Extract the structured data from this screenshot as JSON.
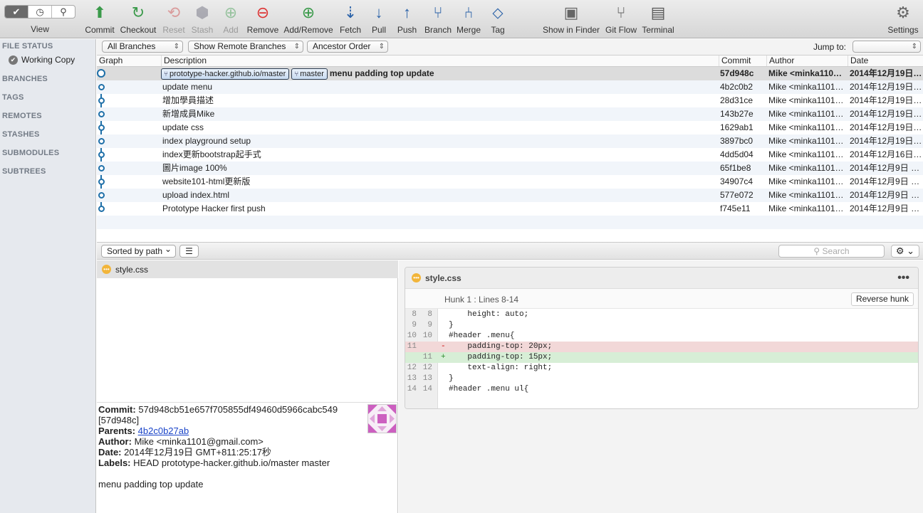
{
  "toolbar": {
    "view_label": "View",
    "view_segments": [
      "✔",
      "◷",
      "⚲"
    ],
    "buttons": [
      {
        "label": "Commit",
        "icon": "⬆"
      },
      {
        "label": "Checkout",
        "icon": "↻"
      },
      {
        "label": "Reset",
        "icon": "⟲"
      },
      {
        "label": "Stash",
        "icon": "⬢"
      },
      {
        "label": "Add",
        "icon": "⊕"
      },
      {
        "label": "Remove",
        "icon": "⊖"
      },
      {
        "label": "Add/Remove",
        "icon": "⊕"
      },
      {
        "label": "Fetch",
        "icon": "⇣"
      },
      {
        "label": "Pull",
        "icon": "↓"
      },
      {
        "label": "Push",
        "icon": "↑"
      },
      {
        "label": "Branch",
        "icon": "⑂"
      },
      {
        "label": "Merge",
        "icon": "⑃"
      },
      {
        "label": "Tag",
        "icon": "⬦"
      },
      {
        "label": "Show in Finder",
        "icon": "▣"
      },
      {
        "label": "Git Flow",
        "icon": "⑂"
      },
      {
        "label": "Terminal",
        "icon": "▤"
      },
      {
        "label": "Settings",
        "icon": "⚙"
      }
    ]
  },
  "sidebar": {
    "file_status": "FILE STATUS",
    "working_copy": "Working Copy",
    "sections": [
      "BRANCHES",
      "TAGS",
      "REMOTES",
      "STASHES",
      "SUBMODULES",
      "SUBTREES"
    ]
  },
  "filters": {
    "branches": "All Branches",
    "remote": "Show Remote Branches",
    "order": "Ancestor Order",
    "jump_to": "Jump to:"
  },
  "commit_table": {
    "headers": [
      "Graph",
      "Description",
      "Commit",
      "Author",
      "Date"
    ],
    "rows": [
      {
        "badges": [
          "prototype-hacker.github.io/master",
          "master"
        ],
        "desc": "menu padding top update",
        "commit": "57d948c",
        "author": "Mike <minka110…",
        "date": "2014年12月19日…"
      },
      {
        "badges": [],
        "desc": "update menu",
        "commit": "4b2c0b2",
        "author": "Mike <minka1101…",
        "date": "2014年12月19日…"
      },
      {
        "badges": [],
        "desc": "增加學員描述",
        "commit": "28d31ce",
        "author": "Mike <minka1101…",
        "date": "2014年12月19日…"
      },
      {
        "badges": [],
        "desc": "新增成員Mike",
        "commit": "143b27e",
        "author": "Mike <minka1101…",
        "date": "2014年12月19日…"
      },
      {
        "badges": [],
        "desc": "update css",
        "commit": "1629ab1",
        "author": "Mike <minka1101…",
        "date": "2014年12月19日…"
      },
      {
        "badges": [],
        "desc": "index playground setup",
        "commit": "3897bc0",
        "author": "Mike <minka1101…",
        "date": "2014年12月19日…"
      },
      {
        "badges": [],
        "desc": "index更新bootstrap起手式",
        "commit": "4dd5d04",
        "author": "Mike <minka1101…",
        "date": "2014年12月16日…"
      },
      {
        "badges": [],
        "desc": "圖片image 100%",
        "commit": "65f1be8",
        "author": "Mike <minka1101…",
        "date": "2014年12月9日 1…"
      },
      {
        "badges": [],
        "desc": "website101-html更新版",
        "commit": "34907c4",
        "author": "Mike <minka1101…",
        "date": "2014年12月9日 1…"
      },
      {
        "badges": [],
        "desc": "upload index.html",
        "commit": "577e072",
        "author": "Mike <minka1101…",
        "date": "2014年12月9日 1…"
      },
      {
        "badges": [],
        "desc": "Prototype Hacker first push",
        "commit": "f745e11",
        "author": "Mike <minka1101…",
        "date": "2014年12月9日 1…"
      }
    ]
  },
  "lower_bar": {
    "sort": "Sorted by path",
    "search_placeholder": "Search"
  },
  "file_list": {
    "files": [
      "style.css"
    ]
  },
  "details": {
    "commit_label": "Commit:",
    "commit_hash": "57d948cb51e657f705855df49460d5966cabc549",
    "short_hash": "[57d948c]",
    "parents_label": "Parents:",
    "parents": "4b2c0b27ab",
    "author_label": "Author:",
    "author": "Mike <minka1101@gmail.com>",
    "date_label": "Date:",
    "date": "2014年12月19日 GMT+811:25:17秒",
    "labels_label": "Labels:",
    "labels": "HEAD prototype-hacker.github.io/master master",
    "message": "menu padding top update"
  },
  "diff": {
    "filename": "style.css",
    "hunk_title": "Hunk 1 : Lines 8-14",
    "reverse_label": "Reverse hunk",
    "lines": [
      {
        "old": "8",
        "new": "8",
        "type": "ctx",
        "mark": "",
        "text": "    height: auto;"
      },
      {
        "old": "9",
        "new": "9",
        "type": "ctx",
        "mark": "",
        "text": "}"
      },
      {
        "old": "10",
        "new": "10",
        "type": "ctx",
        "mark": "",
        "text": "#header .menu{"
      },
      {
        "old": "11",
        "new": "",
        "type": "del",
        "mark": "-",
        "text": "    padding-top: 20px;"
      },
      {
        "old": "",
        "new": "11",
        "type": "add",
        "mark": "+",
        "text": "    padding-top: 15px;"
      },
      {
        "old": "12",
        "new": "12",
        "type": "ctx",
        "mark": "",
        "text": "    text-align: right;"
      },
      {
        "old": "13",
        "new": "13",
        "type": "ctx",
        "mark": "",
        "text": "}"
      },
      {
        "old": "14",
        "new": "14",
        "type": "ctx",
        "mark": "",
        "text": "#header .menu ul{"
      }
    ]
  }
}
